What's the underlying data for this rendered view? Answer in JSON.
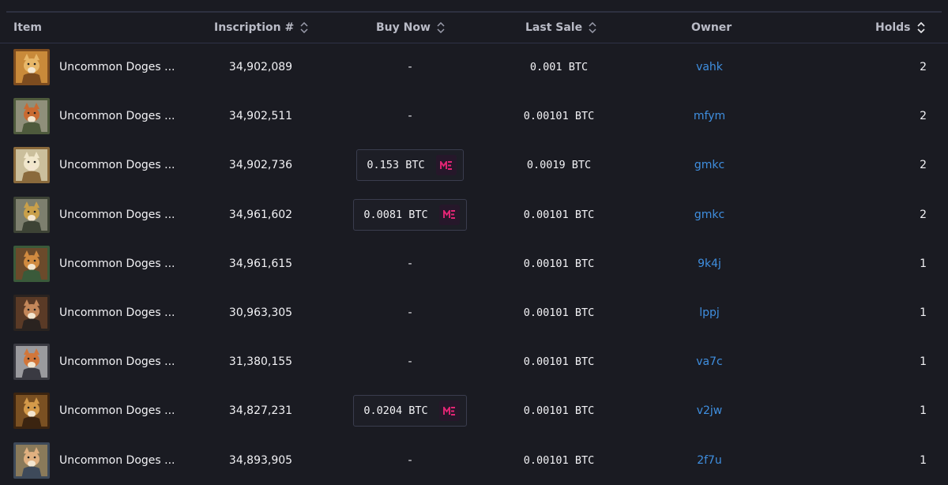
{
  "headers": {
    "item": "Item",
    "inscription": "Inscription #",
    "buy_now": "Buy Now",
    "last_sale": "Last Sale",
    "owner": "Owner",
    "holds": "Holds"
  },
  "colors": {
    "background": "#1a1b22",
    "owner_link": "#3f8fe0",
    "marketplace_accent": "#e42575"
  },
  "rows": [
    {
      "name": "Uncommon Doges ...",
      "inscription": "34,902,089",
      "buy_now": "-",
      "last_sale": "0.001 BTC",
      "owner": "vahk",
      "holds": "2",
      "thumb": [
        "#c98a3a",
        "#e7b769",
        "#7d4c1f"
      ]
    },
    {
      "name": "Uncommon Doges ...",
      "inscription": "34,902,511",
      "buy_now": "-",
      "last_sale": "0.00101 BTC",
      "owner": "mfym",
      "holds": "2",
      "thumb": [
        "#8f8f7a",
        "#c96a32",
        "#4e5a3c"
      ]
    },
    {
      "name": "Uncommon Doges ...",
      "inscription": "34,902,736",
      "buy_now": "0.153 BTC",
      "last_sale": "0.0019 BTC",
      "owner": "gmkc",
      "holds": "2",
      "thumb": [
        "#cbbf9c",
        "#f1e7cc",
        "#8a6a3c"
      ]
    },
    {
      "name": "Uncommon Doges ...",
      "inscription": "34,961,602",
      "buy_now": "0.0081 BTC",
      "last_sale": "0.00101 BTC",
      "owner": "gmkc",
      "holds": "2",
      "thumb": [
        "#7d7f6e",
        "#c9a04a",
        "#3d4335"
      ]
    },
    {
      "name": "Uncommon Doges ...",
      "inscription": "34,961,615",
      "buy_now": "-",
      "last_sale": "0.00101 BTC",
      "owner": "9k4j",
      "holds": "1",
      "thumb": [
        "#6b4a2b",
        "#d08a40",
        "#3a5a3a"
      ]
    },
    {
      "name": "Uncommon Doges ...",
      "inscription": "30,963,305",
      "buy_now": "-",
      "last_sale": "0.00101 BTC",
      "owner": "lppj",
      "holds": "1",
      "thumb": [
        "#5a3a26",
        "#c4875a",
        "#2a2320"
      ]
    },
    {
      "name": "Uncommon Doges ...",
      "inscription": "31,380,155",
      "buy_now": "-",
      "last_sale": "0.00101 BTC",
      "owner": "va7c",
      "holds": "1",
      "thumb": [
        "#9a9a9e",
        "#d2763a",
        "#3a3a42"
      ]
    },
    {
      "name": "Uncommon Doges ...",
      "inscription": "34,827,231",
      "buy_now": "0.0204 BTC",
      "last_sale": "0.00101 BTC",
      "owner": "v2jw",
      "holds": "1",
      "thumb": [
        "#7a5022",
        "#d49a4a",
        "#3b2410"
      ]
    },
    {
      "name": "Uncommon Doges ...",
      "inscription": "34,893,905",
      "buy_now": "-",
      "last_sale": "0.00101 BTC",
      "owner": "2f7u",
      "holds": "1",
      "thumb": [
        "#8a7a5a",
        "#e0b080",
        "#3e4a5a"
      ]
    }
  ]
}
